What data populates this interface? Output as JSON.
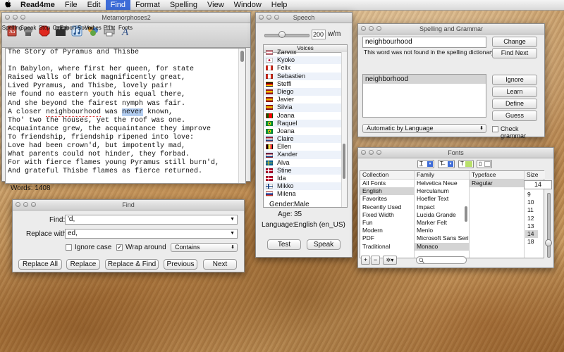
{
  "menubar": {
    "app_name": "Read4me",
    "items": [
      "File",
      "Edit",
      "Find",
      "Format",
      "Spelling",
      "View",
      "Window",
      "Help"
    ],
    "active": "Find"
  },
  "document": {
    "title": "Metamorphoses2",
    "toolbar": [
      "Spelling",
      "Speak",
      "Stop",
      "Coach",
      "Export Sound",
      "Voices",
      "Print",
      "Fonts"
    ],
    "lines": [
      "The Story of Pyramus and Thisbe",
      "",
      "In Babylon, where first her queen, for state",
      "Raised walls of brick magnificently great,",
      "Lived Pyramus, and Thisbe, lovely pair!",
      "He found no eastern youth his equal there,",
      "And she beyond the fairest nymph was fair.",
      "A closer neighbourhood was never known,",
      "Tho' two the houses, yet the roof was one.",
      "Acquaintance grew, the acquaintance they improve",
      "To friendship, friendship ripened into love:",
      "Love had been crown'd, but impotently mad,",
      "What parents could not hinder, they forbad.",
      "For with fierce flames young Pyramus still burn'd,",
      "And grateful Thisbe flames as fierce returned."
    ],
    "line7": {
      "before": "A closer ",
      "misspelled": "neighbourhood",
      "mid": " was ",
      "highlighted": "never",
      "after": " known,"
    },
    "word_count": "Words:  1408"
  },
  "find": {
    "title": "Find",
    "find_label": "Find:",
    "find_value": "'d,",
    "replace_label": "Replace with:",
    "replace_value": "ed,",
    "ignore_case": "Ignore case",
    "ignore_case_checked": false,
    "wrap_around": "Wrap around",
    "wrap_around_checked": true,
    "match_mode": "Contains",
    "buttons": [
      "Replace All",
      "Replace",
      "Replace & Find",
      "Previous",
      "Next"
    ]
  },
  "speech": {
    "title": "Speech",
    "rate_value": "200",
    "rate_unit": "w/m",
    "rate": 0.38,
    "voices_header": "Voices",
    "voices": [
      {
        "name": "Zarvox",
        "flag": "us"
      },
      {
        "name": "Kyoko",
        "flag": "jp"
      },
      {
        "name": "Felix",
        "flag": "ca"
      },
      {
        "name": "Sebastien",
        "flag": "ca"
      },
      {
        "name": "Steffi",
        "flag": "de"
      },
      {
        "name": "Diego",
        "flag": "es"
      },
      {
        "name": "Javier",
        "flag": "es"
      },
      {
        "name": "Silvia",
        "flag": "es"
      },
      {
        "name": "Joana",
        "flag": "pt"
      },
      {
        "name": "Raquel",
        "flag": "br"
      },
      {
        "name": "Joana",
        "flag": "br"
      },
      {
        "name": "Claire",
        "flag": "nl"
      },
      {
        "name": "Ellen",
        "flag": "be"
      },
      {
        "name": "Xander",
        "flag": "nl"
      },
      {
        "name": "Alva",
        "flag": "se"
      },
      {
        "name": "Stine",
        "flag": "no"
      },
      {
        "name": "Ida",
        "flag": "dk"
      },
      {
        "name": "Mikko",
        "flag": "fi"
      },
      {
        "name": "Milena",
        "flag": "ru"
      }
    ],
    "gender_label": "Gender:",
    "gender": "Male",
    "age_label": "Age:",
    "age": "35",
    "language_label": "Language:",
    "language": "English (en_US)",
    "test_button": "Test",
    "speak_button": "Speak"
  },
  "spelling": {
    "title": "Spelling and Grammar",
    "word": "neighbourhood",
    "message": "This word was not found in the spelling dictionary.",
    "guess": "neighborhood",
    "language": "Automatic by Language",
    "check_grammar": "Check grammar",
    "buttons": [
      "Change",
      "Find Next",
      "Ignore",
      "Learn",
      "Define",
      "Guess"
    ]
  },
  "fonts": {
    "title": "Fonts",
    "collection_header": "Collection",
    "family_header": "Family",
    "typeface_header": "Typeface",
    "size_header": "Size",
    "collections": [
      "All Fonts",
      "English",
      "Favorites",
      "Recently Used",
      "Fixed Width",
      "Fun",
      "Modern",
      "PDF",
      "Traditional"
    ],
    "selected_collection": "English",
    "families": [
      "Helvetica Neue",
      "Herculanum",
      "Hoefler Text",
      "Impact",
      "Lucida Grande",
      "Marker Felt",
      "Menlo",
      "Microsoft Sans Serif",
      "Monaco"
    ],
    "selected_family": "Monaco",
    "typefaces": [
      "Regular"
    ],
    "size_value": "14",
    "sizes": [
      "9",
      "10",
      "11",
      "12",
      "13",
      "14",
      "18"
    ],
    "selected_size": "14",
    "add_label": "+",
    "remove_label": "−",
    "action_label": "✲▾"
  }
}
